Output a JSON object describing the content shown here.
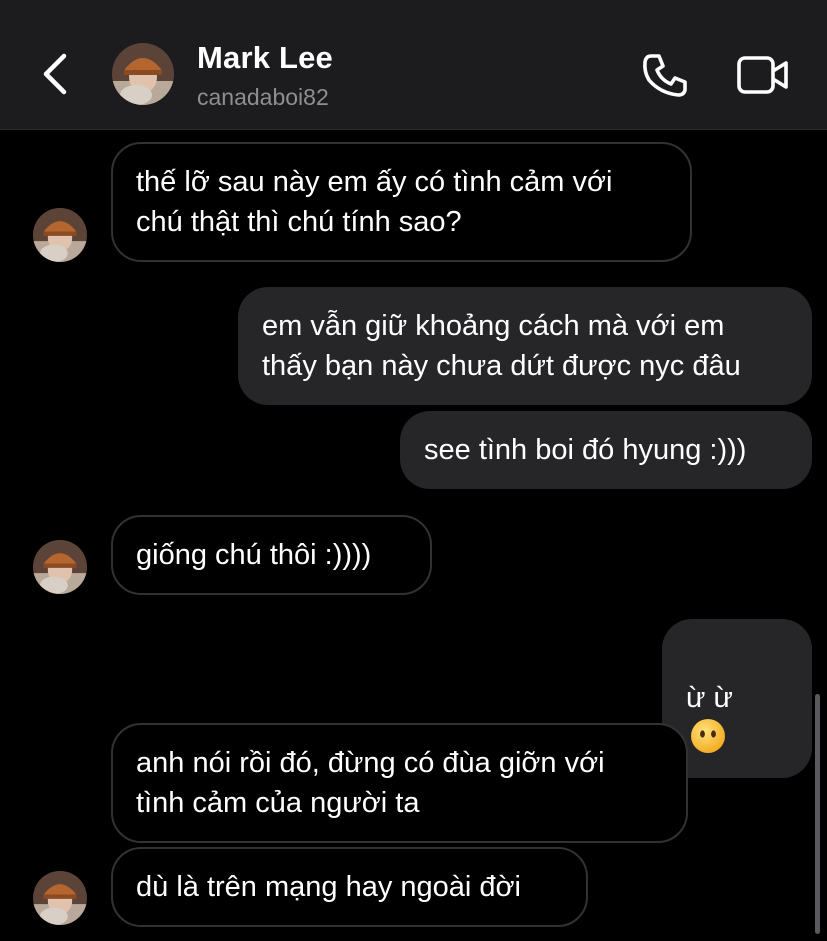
{
  "header": {
    "name": "Mark Lee",
    "username": "canadaboi82"
  },
  "icons": {
    "back": "chevron-left-icon",
    "call": "phone-icon",
    "video": "video-camera-icon",
    "emoji": "face-without-mouth-emoji"
  },
  "colors": {
    "background": "#000000",
    "header": "#1c1c1e",
    "outgoing_bubble": "#262628",
    "incoming_border": "#323234",
    "username": "#8e8e93"
  },
  "messages": [
    {
      "sender": "them",
      "text": "thế lỡ sau này em ấy có tình cảm với\nchú thật thì chú tính sao?"
    },
    {
      "sender": "me",
      "text": "em vẫn giữ khoảng cách mà với em\nthấy bạn này chưa dứt được nyc đâu"
    },
    {
      "sender": "me",
      "text": "see tình boi đó hyung :)))"
    },
    {
      "sender": "them",
      "text": "giống chú thôi :))))"
    },
    {
      "sender": "me",
      "text": "ừ ừ"
    },
    {
      "sender": "them",
      "text": "anh nói rồi đó, đừng có đùa giỡn với\ntình cảm của người ta"
    },
    {
      "sender": "them",
      "text": "dù là trên mạng hay ngoài đời"
    }
  ]
}
